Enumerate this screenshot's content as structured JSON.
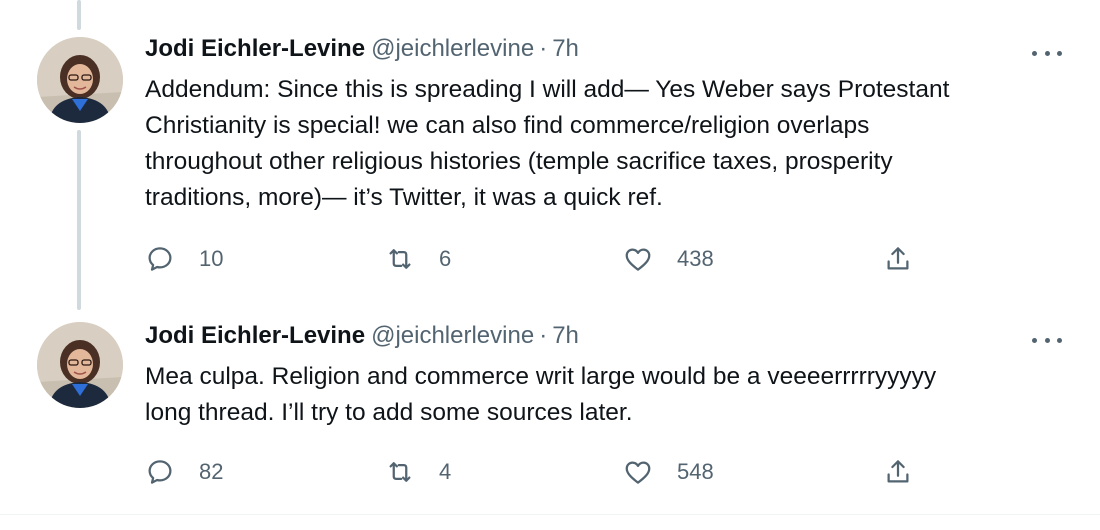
{
  "tweets": [
    {
      "author_name": "Jodi Eichler-Levine",
      "handle": "@jeichlerlevine",
      "separator": "·",
      "time": "7h",
      "text": "Addendum: Since this is spreading I will add— Yes Weber says Protestant\nChristianity is special! we can also find commerce/religion overlaps\nthroughout other religious histories (temple sacrifice taxes, prosperity\ntraditions, more)— it’s Twitter, it was a quick ref.",
      "replies": "10",
      "retweets": "6",
      "likes": "438"
    },
    {
      "author_name": "Jodi Eichler-Levine",
      "handle": "@jeichlerlevine",
      "separator": "·",
      "time": "7h",
      "text": "Mea culpa. Religion and commerce writ large would be a veeeerrrrryyyyy\nlong thread. I’ll try to add some sources later.",
      "replies": "82",
      "retweets": "4",
      "likes": "548"
    }
  ],
  "icons": {
    "reply": "reply-icon",
    "retweet": "retweet-icon",
    "like": "heart-icon",
    "share": "share-icon",
    "more": "more-icon"
  },
  "colors": {
    "text": "#0f1419",
    "secondary": "#536471",
    "thread_line": "#cfd9de"
  }
}
